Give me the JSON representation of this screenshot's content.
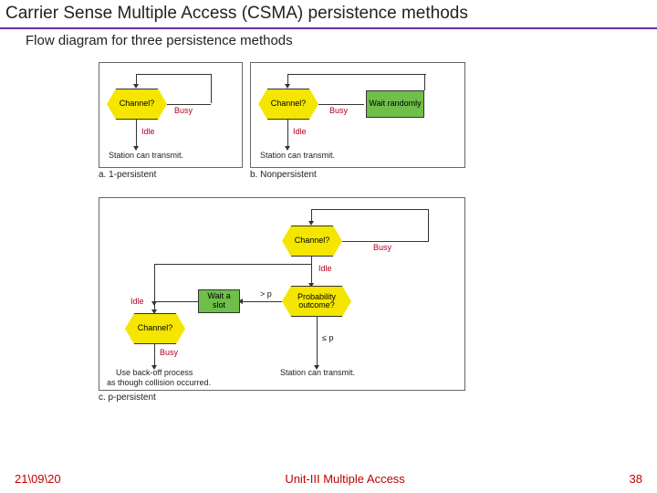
{
  "title": "Carrier Sense Multiple Access (CSMA) persistence methods",
  "subtitle": "Flow diagram for three persistence methods",
  "labels": {
    "channel": "Channel?",
    "busy": "Busy",
    "idle": "Idle",
    "wait_random": "Wait randomly",
    "station_transmit": "Station can transmit.",
    "wait_slot": "Wait a slot",
    "prob_outcome": "Probability outcome?",
    "gtp": "> p",
    "lep": "≤ p",
    "backoff1": "Use back-off process",
    "backoff2": "as though collision occurred."
  },
  "captions": {
    "a": "a. 1-persistent",
    "b": "b. Nonpersistent",
    "c": "c. p-persistent"
  },
  "footer": {
    "date": "21\\09\\20",
    "unit": "Unit-III Multiple Access",
    "page": "38"
  }
}
